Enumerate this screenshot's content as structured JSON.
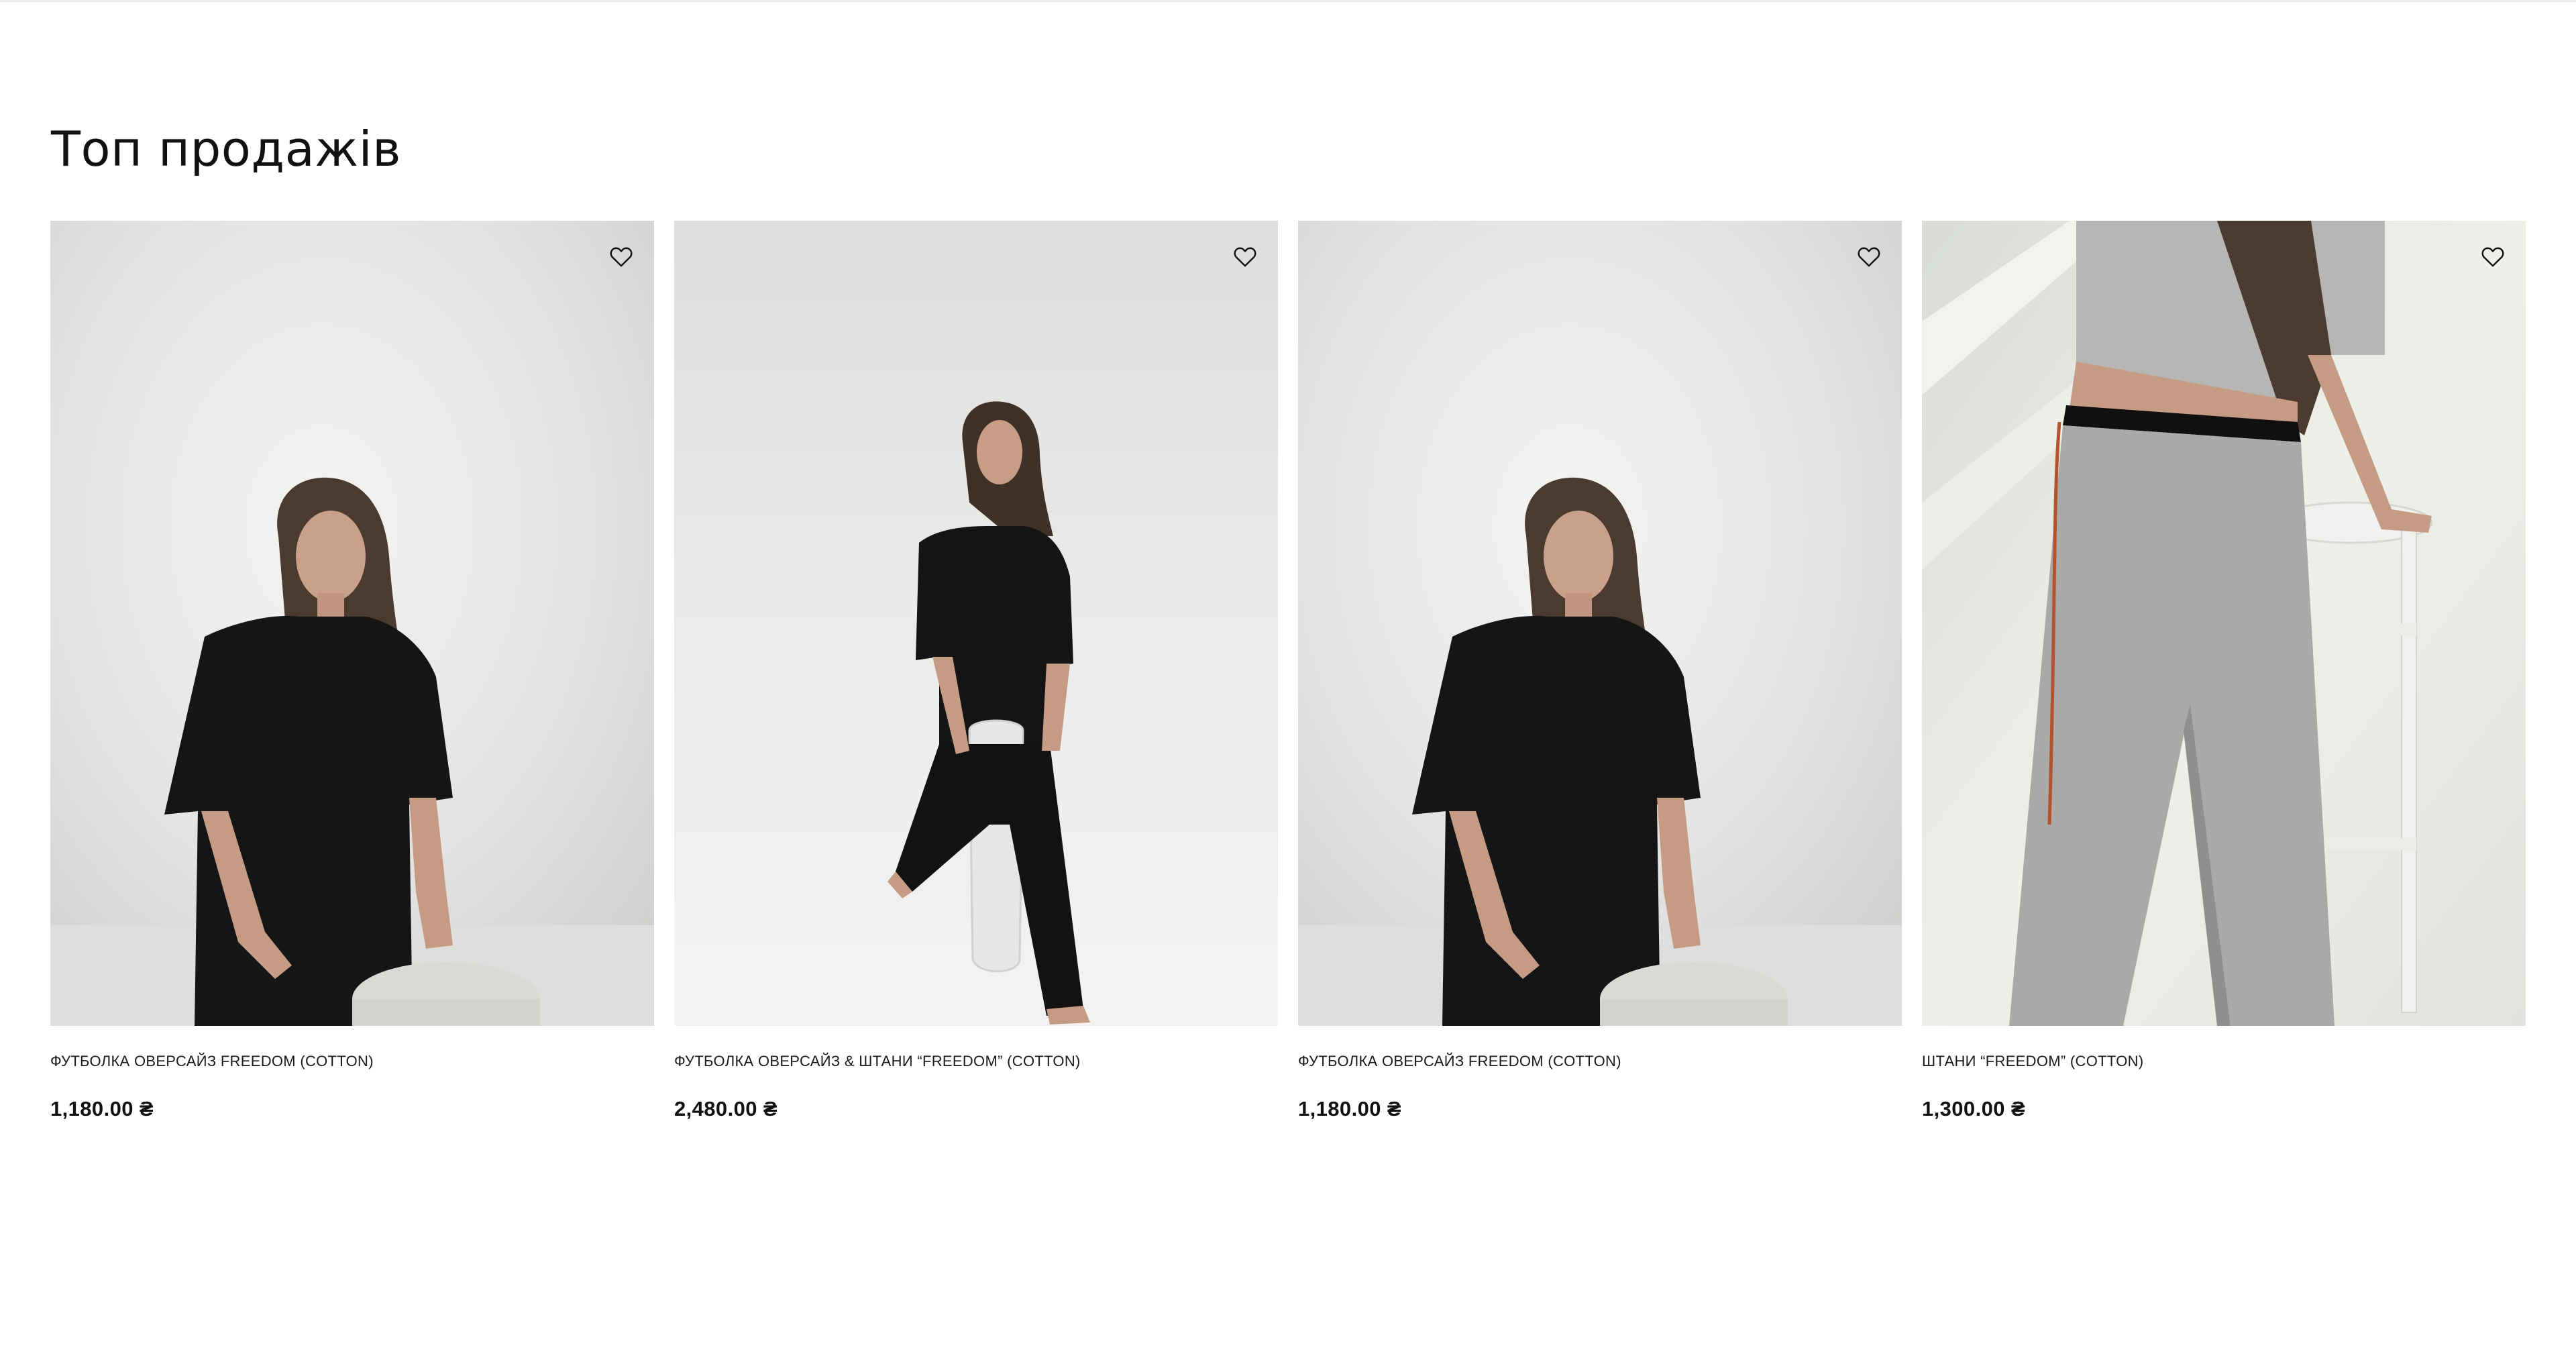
{
  "section": {
    "title": "Топ продажів"
  },
  "products": [
    {
      "title": "ФУТБОЛКА ОВЕРСАЙЗ FREEDOM (COTTON)",
      "price": "1,180.00 ₴",
      "wishlist_icon": "heart-outline-icon"
    },
    {
      "title": "ФУТБОЛКА ОВЕРСАЙЗ & ШТАНИ “FREEDOM” (COTTON)",
      "price": "2,480.00 ₴",
      "wishlist_icon": "heart-outline-icon"
    },
    {
      "title": "ФУТБОЛКА ОВЕРСАЙЗ FREEDOM (COTTON)",
      "price": "1,180.00 ₴",
      "wishlist_icon": "heart-outline-icon"
    },
    {
      "title": "ШТАНИ “FREEDOM” (COTTON)",
      "price": "1,300.00 ₴",
      "wishlist_icon": "heart-outline-icon"
    }
  ],
  "colors": {
    "background": "#ffffff",
    "text": "#111111",
    "photo_backdrop": "#e6e6e4"
  }
}
